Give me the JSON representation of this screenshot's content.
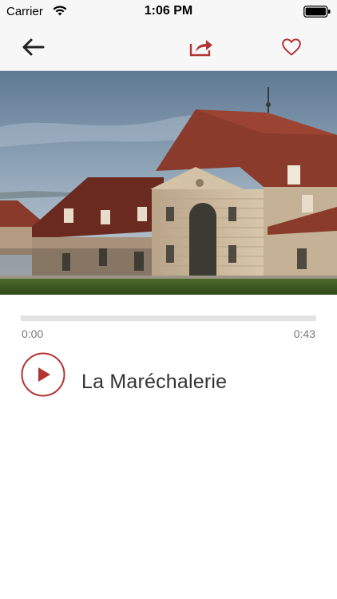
{
  "status_bar": {
    "carrier": "Carrier",
    "time": "1:06 PM"
  },
  "nav": {
    "back_icon": "arrow-left-icon",
    "share_icon": "share-icon",
    "favorite_icon": "heart-outline-icon"
  },
  "hero": {
    "image_icon": "building-photo"
  },
  "player": {
    "time_current": "0:00",
    "time_total": "0:43",
    "progress": 0,
    "play_icon": "play-icon",
    "title": "La Maréchalerie"
  },
  "colors": {
    "accent": "#b23535",
    "bar_background": "#f7f7f7",
    "track": "#e3e3e3",
    "text": "#333333"
  }
}
